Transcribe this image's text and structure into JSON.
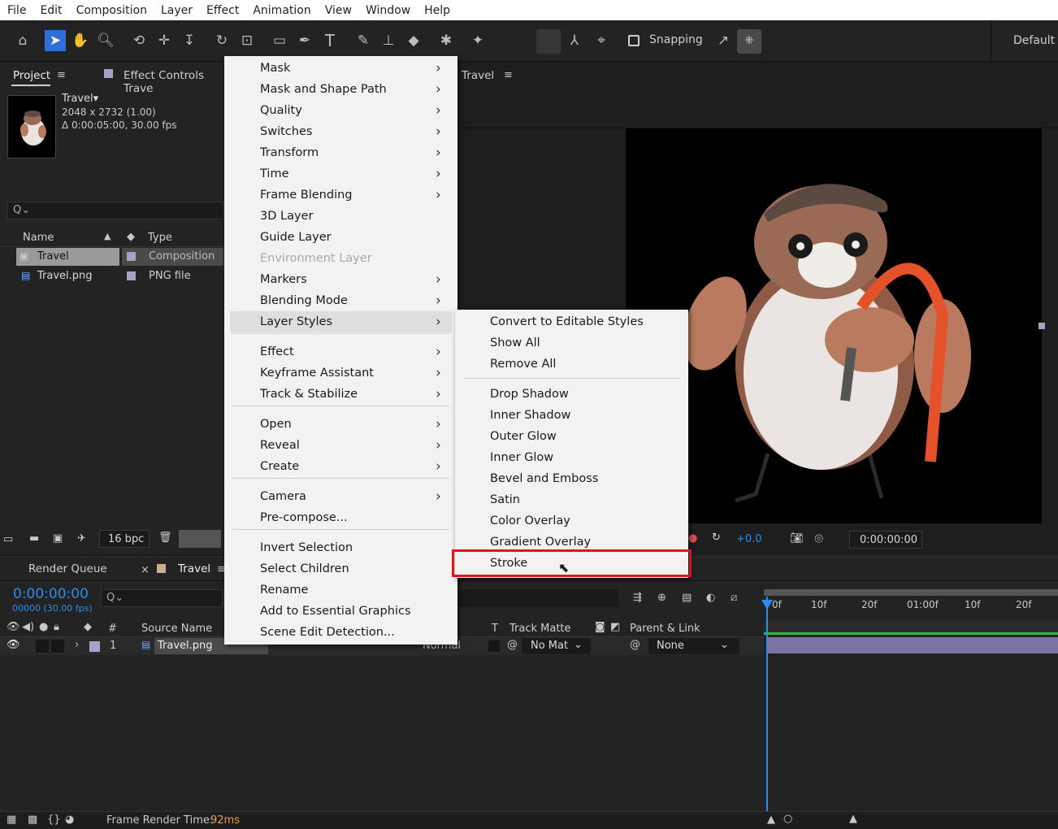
{
  "menubar": [
    "File",
    "Edit",
    "Composition",
    "Layer",
    "Effect",
    "Animation",
    "View",
    "Window",
    "Help"
  ],
  "toolbar": {
    "snapping_label": "Snapping",
    "workspace_label": "Default"
  },
  "project_panel": {
    "tab_project": "Project",
    "tab_effect_controls": "Effect Controls Trave",
    "comp_tab": "Travel",
    "item_name": "Travel▾",
    "item_dims": "2048 x 2732 (1.00)",
    "item_duration": "Δ 0:00:05:00, 30.00 fps",
    "search_icon_text": "Q⌄",
    "col_name": "Name",
    "col_type": "Type",
    "rows": [
      {
        "name": "Travel",
        "type": "Composition",
        "swatch": "#a9a2c6"
      },
      {
        "name": "Travel.png",
        "type": "PNG file",
        "swatch": "#a9a2c6"
      }
    ],
    "bpc": "16 bpc"
  },
  "viewer": {
    "exposure": "+0.0",
    "timecode": "0:00:00:00"
  },
  "timeline": {
    "tab_render_queue": "Render Queue",
    "tab_travel": "Travel",
    "timecode": "0:00:00:00",
    "frames": "00000 (30.00 fps)",
    "col_hash": "#",
    "col_source": "Source Name",
    "col_t": "T",
    "col_track_matte": "Track Matte",
    "col_parent": "Parent & Link",
    "layer_num": "1",
    "layer_name": "Travel.png",
    "track_matte_value": "No Mat",
    "parent_value": "None",
    "mode_value": "Normal",
    "ruler": [
      "0f",
      "10f",
      "20f",
      "01:00f",
      "10f",
      "20f"
    ]
  },
  "status": {
    "frame_render_label": "Frame Render Time:",
    "frame_render_value": "92ms"
  },
  "context_menu": {
    "items": [
      {
        "label": "Mask",
        "sub": true
      },
      {
        "label": "Mask and Shape Path",
        "sub": true
      },
      {
        "label": "Quality",
        "sub": true
      },
      {
        "label": "Switches",
        "sub": true
      },
      {
        "label": "Transform",
        "sub": true
      },
      {
        "label": "Time",
        "sub": true
      },
      {
        "label": "Frame Blending",
        "sub": true
      },
      {
        "label": "3D Layer",
        "sub": false
      },
      {
        "label": "Guide Layer",
        "sub": false
      },
      {
        "label": "Environment Layer",
        "sub": false,
        "disabled": true
      },
      {
        "label": "Markers",
        "sub": true
      },
      {
        "label": "Blending Mode",
        "sub": true
      },
      {
        "label": "Layer Styles",
        "sub": true,
        "highlight": true
      },
      {
        "label": "Effect",
        "sub": true
      },
      {
        "label": "Keyframe Assistant",
        "sub": true
      },
      {
        "label": "Track & Stabilize",
        "sub": true
      },
      {
        "label": "Open",
        "sub": true
      },
      {
        "label": "Reveal",
        "sub": true
      },
      {
        "label": "Create",
        "sub": true
      },
      {
        "label": "Camera",
        "sub": true
      },
      {
        "label": "Pre-compose...",
        "sub": false
      },
      {
        "label": "Invert Selection",
        "sub": false
      },
      {
        "label": "Select Children",
        "sub": false
      },
      {
        "label": "Rename",
        "sub": false
      },
      {
        "label": "Add to Essential Graphics",
        "sub": false
      },
      {
        "label": "Scene Edit Detection...",
        "sub": false
      }
    ]
  },
  "submenu": {
    "items": [
      "Convert to Editable Styles",
      "Show All",
      "Remove All",
      "Drop Shadow",
      "Inner Shadow",
      "Outer Glow",
      "Inner Glow",
      "Bevel and Emboss",
      "Satin",
      "Color Overlay",
      "Gradient Overlay",
      "Stroke"
    ],
    "selected": "Stroke",
    "highlight_color": "#e0141e"
  },
  "colors": {
    "accent_blue": "#2d8ceb",
    "label_purple": "#a9a2c6"
  }
}
